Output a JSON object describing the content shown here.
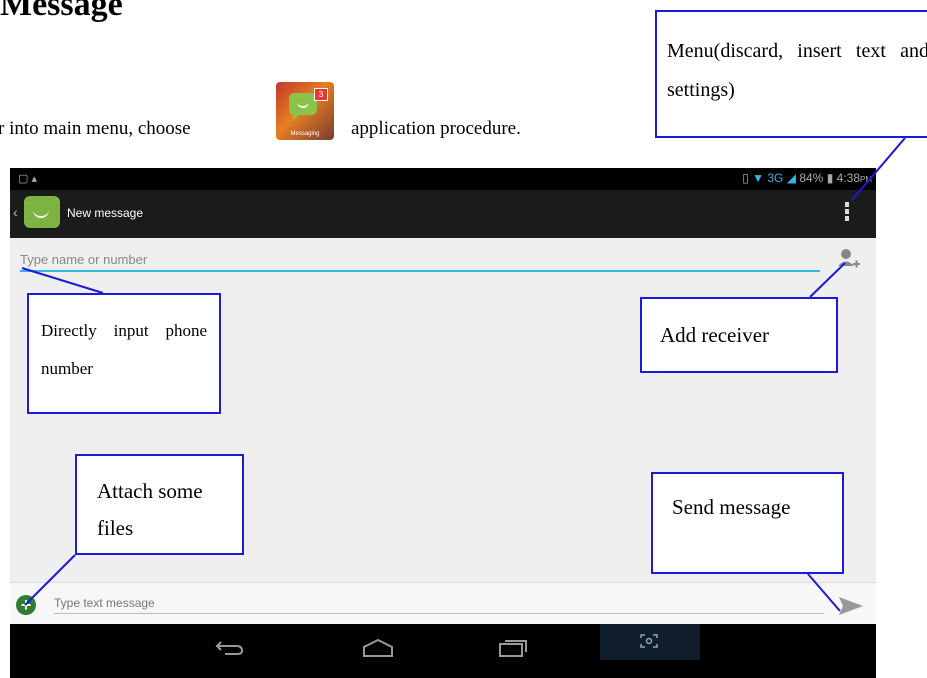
{
  "doc": {
    "title": "Message",
    "intro_prefix": "r into main menu, choose",
    "intro_suffix": "application procedure.",
    "app_icon": {
      "name": "messaging-app-icon",
      "caption": "Messaging",
      "badge": "3",
      "accent": "#8bc34a"
    }
  },
  "device": {
    "status": {
      "left": "▢ ▴",
      "network": "3G",
      "battery": "84%",
      "time": "4:38",
      "ampm": "PM"
    },
    "actionbar": {
      "title": "New message"
    },
    "to_field": {
      "placeholder": "Type name or number"
    },
    "compose": {
      "placeholder": "Type text message"
    },
    "colors": {
      "accent": "#33b5e5",
      "actionbar": "#1b1b1b",
      "background": "#efefef"
    }
  },
  "callouts": {
    "menu": "Menu(discard, insert text and settings)",
    "direct_input": "Directly input phone number",
    "add_receiver": "Add receiver",
    "attach": "Attach some files",
    "send": "Send message"
  }
}
